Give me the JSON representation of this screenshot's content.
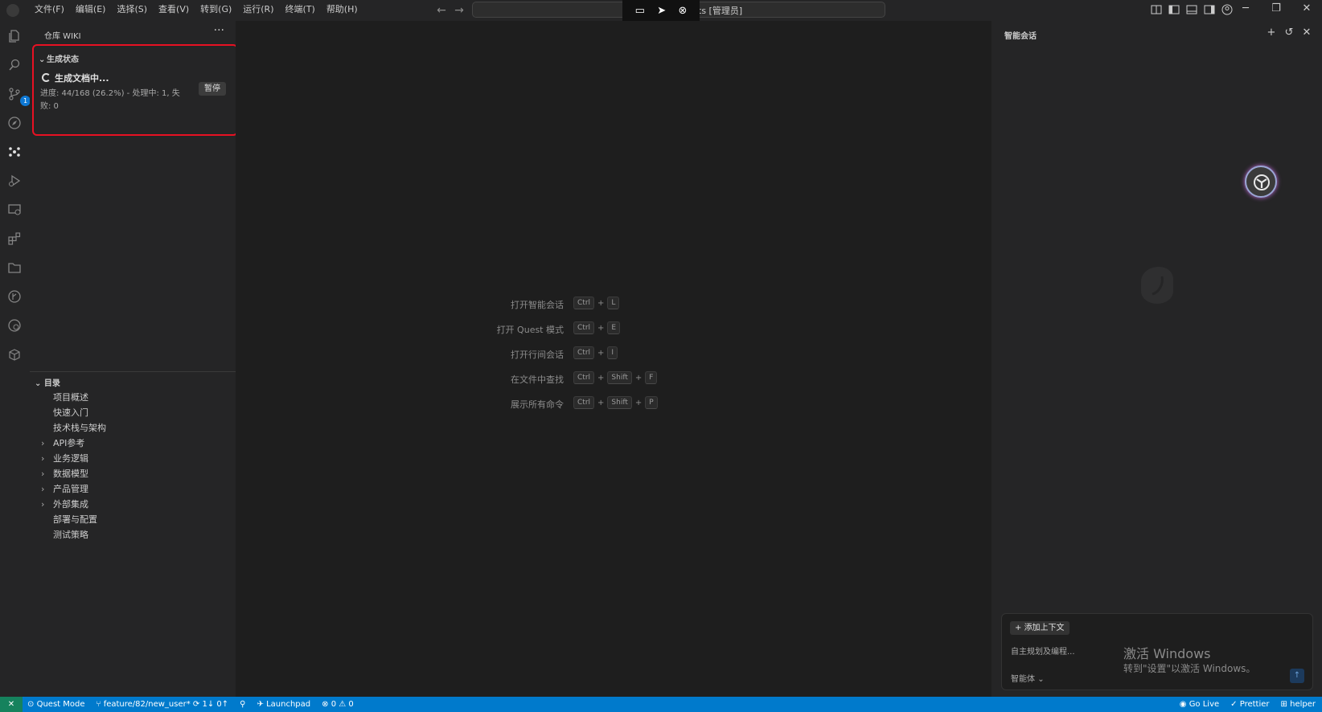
{
  "menu": [
    "文件(F)",
    "编辑(E)",
    "选择(S)",
    "查看(V)",
    "转到(G)",
    "运行(R)",
    "终端(T)",
    "帮助(H)"
  ],
  "command_center": {
    "text": "ts [管理员]"
  },
  "activity_bar": {
    "source_control_badge": "1"
  },
  "sidebar": {
    "header": "仓库 WIKI",
    "more": "···",
    "generation": {
      "section_title": "生成状态",
      "status": "生成文档中...",
      "progress": "进度: 44/168 (26.2%) - 处理中: 1, 失败: 0",
      "pause_label": "暂停"
    },
    "toc": {
      "title": "目录",
      "items": [
        {
          "label": "项目概述",
          "expandable": false
        },
        {
          "label": "快速入门",
          "expandable": false
        },
        {
          "label": "技术栈与架构",
          "expandable": false
        },
        {
          "label": "API参考",
          "expandable": true
        },
        {
          "label": "业务逻辑",
          "expandable": true
        },
        {
          "label": "数据模型",
          "expandable": true
        },
        {
          "label": "产品管理",
          "expandable": true
        },
        {
          "label": "外部集成",
          "expandable": true
        },
        {
          "label": "部署与配置",
          "expandable": false
        },
        {
          "label": "测试策略",
          "expandable": false
        }
      ]
    }
  },
  "editor": {
    "shortcuts": [
      {
        "label": "打开智能会话",
        "keys": [
          "Ctrl",
          "L"
        ]
      },
      {
        "label": "打开 Quest 模式",
        "keys": [
          "Ctrl",
          "E"
        ]
      },
      {
        "label": "打开行间会话",
        "keys": [
          "Ctrl",
          "I"
        ]
      },
      {
        "label": "在文件中查找",
        "keys": [
          "Ctrl",
          "Shift",
          "F"
        ]
      },
      {
        "label": "展示所有命令",
        "keys": [
          "Ctrl",
          "Shift",
          "P"
        ]
      }
    ],
    "plus": "+"
  },
  "right_panel": {
    "title": "智能会话",
    "add_context": "添加上下文",
    "input_placeholder": "自主规划及编程...",
    "agent_select": "智能体"
  },
  "watermark": {
    "title": "激活 Windows",
    "subtitle": "转到\"设置\"以激活 Windows。"
  },
  "statusbar": {
    "quest_mode": "Quest Mode",
    "branch": "feature/82/new_user*",
    "sync": "1↓ 0↑",
    "launchpad": "Launchpad",
    "errors": "0",
    "warnings": "0",
    "go_live": "Go Live",
    "prettier": "Prettier",
    "helper": "helper"
  }
}
